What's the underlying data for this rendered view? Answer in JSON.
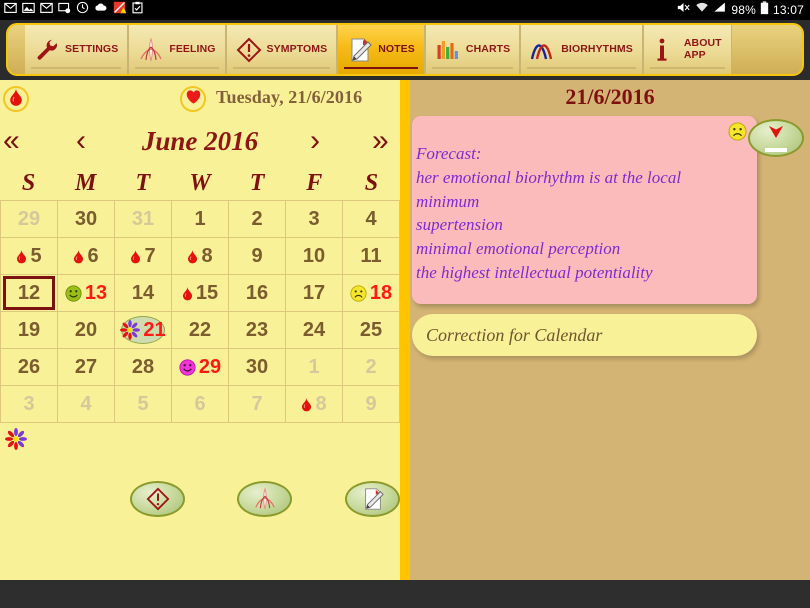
{
  "statusbar": {
    "icons": [
      "mail-icon",
      "image-icon",
      "mail-icon",
      "screenshot-icon",
      "clock-icon",
      "cloud-icon",
      "warning-icon",
      "clipboard-icon"
    ],
    "right_icons": [
      "mute-icon",
      "wifi-icon",
      "signal-icon"
    ],
    "battery_percent": "98%",
    "time": "13:07"
  },
  "tabs": [
    {
      "label": "SETTINGS",
      "icon": "wrench-icon",
      "active": false
    },
    {
      "label": "FEELING",
      "icon": "feeling-icon",
      "active": false
    },
    {
      "label": "SYMPTOMS",
      "icon": "warning-diamond-icon",
      "active": false
    },
    {
      "label": "NOTES",
      "icon": "note-pencil-icon",
      "active": true
    },
    {
      "label": "CHARTS",
      "icon": "bar-chart-icon",
      "active": false
    },
    {
      "label": "BIORHYTHMS",
      "icon": "biorhythm-curves-icon",
      "active": false
    },
    {
      "label": "ABOUT\nAPP",
      "icon": "info-icon",
      "active": false
    }
  ],
  "calendar": {
    "drop_button": "blood-drop-icon",
    "heart_button": "heart-icon",
    "today_label": "Tuesday, 21/6/2016",
    "nav": {
      "prev_year": "«",
      "prev_month": "‹",
      "next_month": "›",
      "next_year": "»"
    },
    "month_title": "June 2016",
    "weekdays": [
      "S",
      "M",
      "T",
      "W",
      "T",
      "F",
      "S"
    ],
    "days": [
      {
        "n": "29",
        "muted": true
      },
      {
        "n": "30",
        "muted": false
      },
      {
        "n": "31",
        "muted": true
      },
      {
        "n": "1",
        "muted": false
      },
      {
        "n": "2",
        "muted": false
      },
      {
        "n": "3",
        "muted": false
      },
      {
        "n": "4",
        "muted": false
      },
      {
        "n": "5",
        "muted": false,
        "icon": "blood-drop-icon"
      },
      {
        "n": "6",
        "muted": false,
        "icon": "blood-drop-icon"
      },
      {
        "n": "7",
        "muted": false,
        "icon": "blood-drop-icon"
      },
      {
        "n": "8",
        "muted": false,
        "icon": "blood-drop-icon"
      },
      {
        "n": "9",
        "muted": false
      },
      {
        "n": "10",
        "muted": false
      },
      {
        "n": "11",
        "muted": false
      },
      {
        "n": "12",
        "muted": false,
        "selected": true
      },
      {
        "n": "13",
        "muted": false,
        "red": true,
        "icon": "happy-face-green-icon"
      },
      {
        "n": "14",
        "muted": false
      },
      {
        "n": "15",
        "muted": false,
        "icon": "blood-drop-icon"
      },
      {
        "n": "16",
        "muted": false
      },
      {
        "n": "17",
        "muted": false
      },
      {
        "n": "18",
        "muted": false,
        "red": true,
        "icon": "sad-face-yellow-icon"
      },
      {
        "n": "19",
        "muted": false
      },
      {
        "n": "20",
        "muted": false
      },
      {
        "n": "21",
        "muted": false,
        "red": true,
        "icon": "flower-icon",
        "marked": true
      },
      {
        "n": "22",
        "muted": false
      },
      {
        "n": "23",
        "muted": false
      },
      {
        "n": "24",
        "muted": false
      },
      {
        "n": "25",
        "muted": false
      },
      {
        "n": "26",
        "muted": false
      },
      {
        "n": "27",
        "muted": false
      },
      {
        "n": "28",
        "muted": false
      },
      {
        "n": "29",
        "muted": false,
        "red": true,
        "icon": "happy-face-magenta-icon"
      },
      {
        "n": "30",
        "muted": false
      },
      {
        "n": "1",
        "muted": true
      },
      {
        "n": "2",
        "muted": true
      },
      {
        "n": "3",
        "muted": true
      },
      {
        "n": "4",
        "muted": true
      },
      {
        "n": "5",
        "muted": true
      },
      {
        "n": "6",
        "muted": true
      },
      {
        "n": "7",
        "muted": true
      },
      {
        "n": "8",
        "muted": true,
        "icon": "blood-drop-icon"
      },
      {
        "n": "9",
        "muted": true
      }
    ],
    "legend_icon": "flower-icon",
    "action_buttons": [
      {
        "icon": "warning-diamond-icon",
        "name": "symptoms-button"
      },
      {
        "icon": "feeling-icon",
        "name": "feeling-button"
      },
      {
        "icon": "note-pencil-icon",
        "name": "notes-button"
      }
    ]
  },
  "notes_panel": {
    "date": "21/6/2016",
    "mood_icon": "sad-face-yellow-icon",
    "arrow_button_icon": "red-down-arrow-icon",
    "forecast_lines": [
      "Forecast:",
      "her emotional biorhythm is at the local",
      "minimum",
      "supertension",
      "minimal emotional perception",
      "the highest intellectual potentiality"
    ],
    "correction_placeholder": "Correction for Calendar"
  },
  "colors": {
    "left_bg": "#f8f198",
    "right_bg": "#d4b474",
    "divider": "#ffc400",
    "note_bg": "#fcbbbb",
    "note_text": "#7d2bd1",
    "dark_red": "#7d1010",
    "day_text": "#7a5c2e",
    "red_day": "#ff1b13",
    "active_tab": "#f6bb18"
  }
}
